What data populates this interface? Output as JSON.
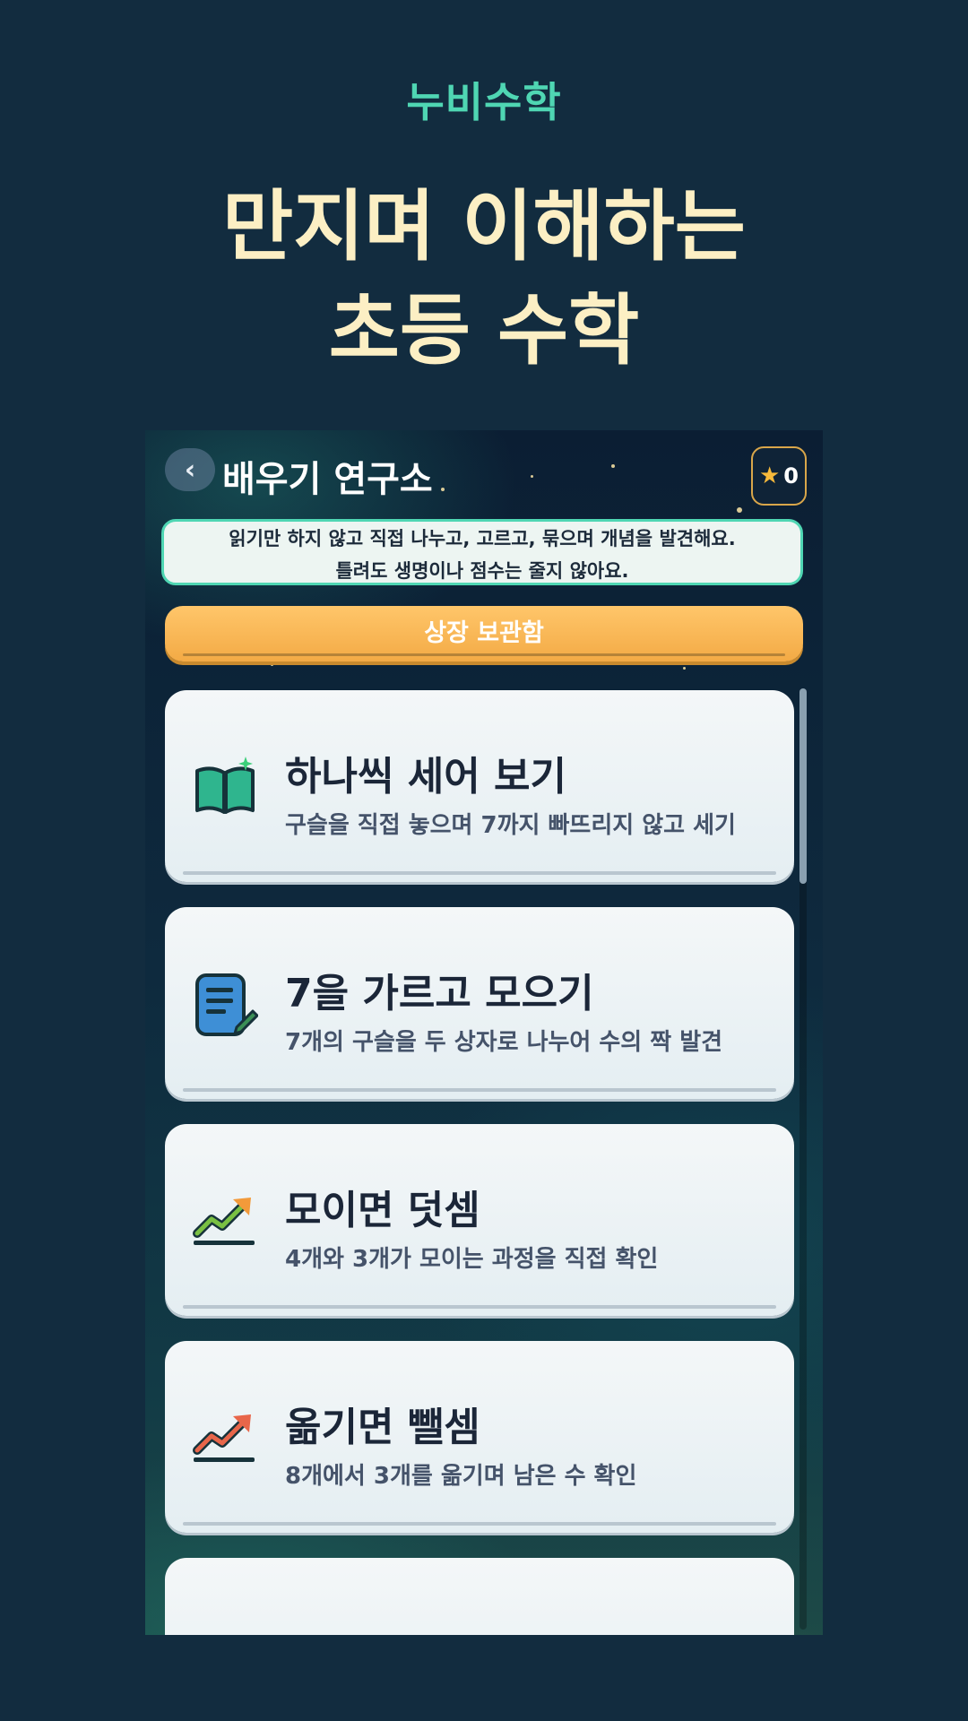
{
  "brand": "누비수학",
  "headline": {
    "line1": "만지며 이해하는",
    "line2": "초등 수학"
  },
  "screen": {
    "back_label": "‹",
    "title": "배우기 연구소",
    "stars": {
      "icon": "star-icon",
      "count": "0"
    },
    "notice": {
      "line1": "읽기만 하지 않고 직접 나누고, 고르고, 묶으며 개념을 발견해요.",
      "line2": "틀려도 생명이나 점수는 줄지 않아요."
    },
    "reward_button": "상장 보관함",
    "lessons": [
      {
        "icon": "open-book-icon",
        "title": "하나씩 세어 보기",
        "subtitle": "구슬을 직접 놓으며 7까지 빠뜨리지 않고 세기"
      },
      {
        "icon": "note-pencil-icon",
        "title": "7을 가르고 모으기",
        "subtitle": "7개의 구슬을 두 상자로 나누어 수의 짝 발견"
      },
      {
        "icon": "trend-up-icon",
        "title": "모이면 덧셈",
        "subtitle": "4개와 3개가 모이는 과정을 직접 확인"
      },
      {
        "icon": "trend-up-icon",
        "title": "옮기면 뺄셈",
        "subtitle": "8개에서 3개를 옮기며 남은 수 확인"
      }
    ]
  },
  "colors": {
    "background": "#122c3f",
    "brand": "#4fd6b3",
    "headline": "#fcefc4",
    "reward_button": "#f8b452",
    "card": "#eef4f6"
  }
}
